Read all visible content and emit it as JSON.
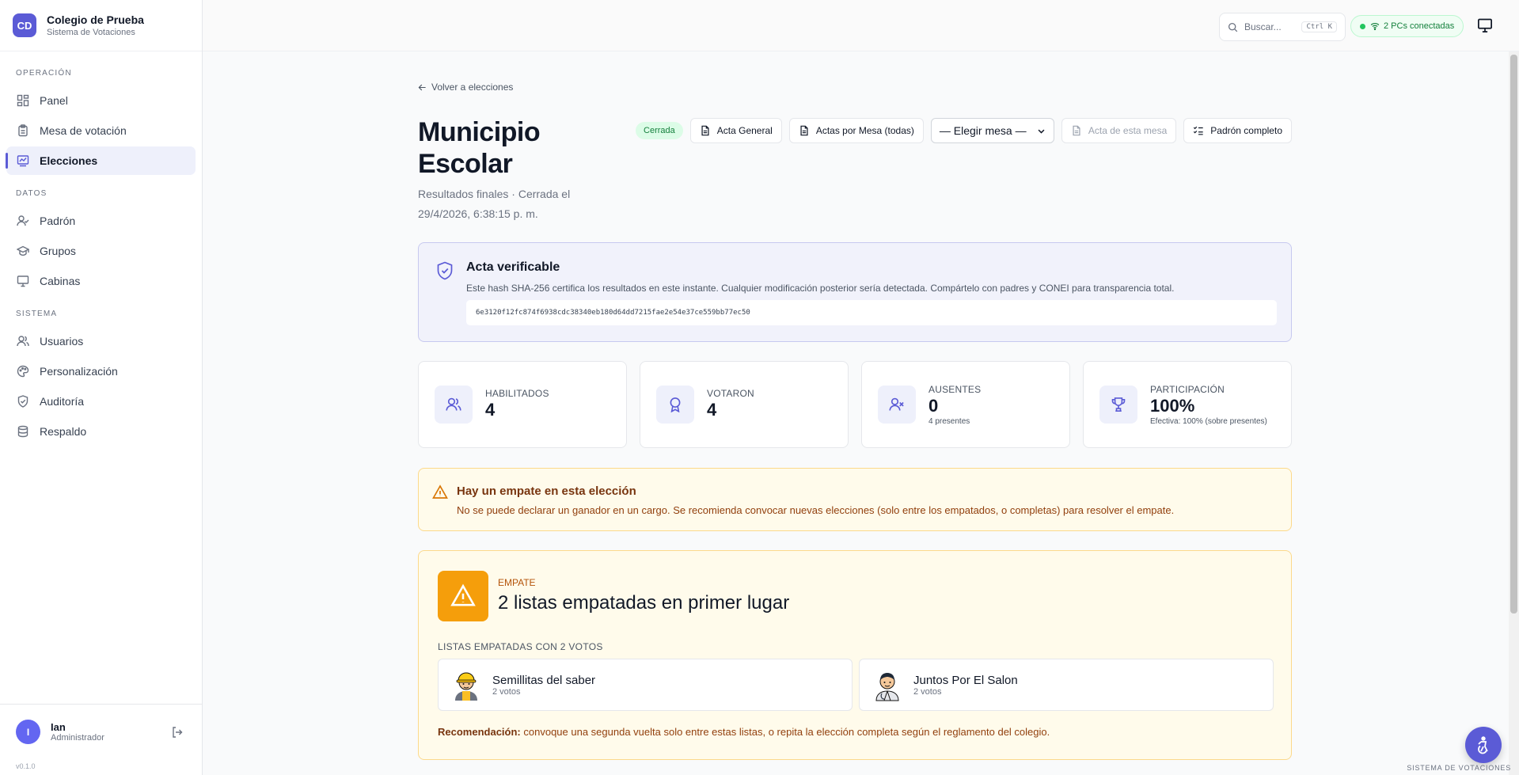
{
  "brand": {
    "initials": "CD",
    "name": "Colegio de Prueba",
    "subtitle": "Sistema de Votaciones"
  },
  "nav": {
    "sections": [
      {
        "label": "OPERACIÓN",
        "items": [
          {
            "label": "Panel",
            "icon": "dashboard-icon"
          },
          {
            "label": "Mesa de votación",
            "icon": "clipboard-icon"
          },
          {
            "label": "Elecciones",
            "icon": "chart-icon",
            "active": true
          }
        ]
      },
      {
        "label": "DATOS",
        "items": [
          {
            "label": "Padrón",
            "icon": "user-check-icon"
          },
          {
            "label": "Grupos",
            "icon": "graduation-cap-icon"
          },
          {
            "label": "Cabinas",
            "icon": "monitor-icon"
          }
        ]
      },
      {
        "label": "SISTEMA",
        "items": [
          {
            "label": "Usuarios",
            "icon": "users-icon"
          },
          {
            "label": "Personalización",
            "icon": "palette-icon"
          },
          {
            "label": "Auditoría",
            "icon": "shield-check-icon"
          },
          {
            "label": "Respaldo",
            "icon": "database-icon"
          }
        ]
      }
    ]
  },
  "user": {
    "initial": "I",
    "name": "Ian",
    "role": "Administrador"
  },
  "version": "v0.1.0",
  "topbar": {
    "search_placeholder": "Buscar...",
    "search_shortcut": "Ctrl K",
    "pcs_status": "2 PCs conectadas"
  },
  "page": {
    "back_label": "Volver a elecciones",
    "title": "Municipio Escolar",
    "subtitle": "Resultados finales · Cerrada el 29/4/2026, 6:38:15 p. m.",
    "status_badge": "Cerrada",
    "actions": {
      "acta_general": "Acta General",
      "actas_por_mesa": "Actas por Mesa (todas)",
      "mesa_select": "— Elegir mesa —",
      "acta_mesa": "Acta de esta mesa",
      "padron": "Padrón completo"
    }
  },
  "hash_card": {
    "title": "Acta verificable",
    "description": "Este hash SHA-256 certifica los resultados en este instante. Cualquier modificación posterior sería detectada. Compártelo con padres y CONEI para transparencia total.",
    "hash": "6e3120f12fc874f6938cdc38340eb180d64dd7215fae2e54e37ce559bb77ec50"
  },
  "stats": [
    {
      "label": "HABILITADOS",
      "value": "4",
      "hint": "",
      "icon": "users-icon"
    },
    {
      "label": "VOTARON",
      "value": "4",
      "hint": "",
      "icon": "award-icon"
    },
    {
      "label": "AUSENTES",
      "value": "0",
      "hint": "4 presentes",
      "icon": "user-x-icon"
    },
    {
      "label": "PARTICIPACIÓN",
      "value": "100%",
      "hint": "Efectiva: 100% (sobre presentes)",
      "icon": "trophy-icon"
    }
  ],
  "warning": {
    "title": "Hay un empate en esta elección",
    "text": "No se puede declarar un ganador en un cargo. Se recomienda convocar nuevas elecciones (solo entre los empatados, o completas) para resolver el empate."
  },
  "tie": {
    "label": "EMPATE",
    "title": "2 listas empatadas en primer lugar",
    "subhead": "LISTAS EMPATADAS CON 2 VOTOS",
    "lists": [
      {
        "name": "Semillitas del saber",
        "votes": "2 votos",
        "icon": "worker-avatar-icon"
      },
      {
        "name": "Juntos Por El Salon",
        "votes": "2 votos",
        "icon": "doctor-avatar-icon"
      }
    ],
    "rec_label": "Recomendación:",
    "rec_text": "convoque una segunda vuelta solo entre estas listas, o repita la elección completa según el reglamento del colegio."
  },
  "footer_tag": "SISTEMA DE VOTACIONES",
  "colors": {
    "accent": "#5b5bd6",
    "success": "#15803d",
    "warning": "#d97706"
  }
}
